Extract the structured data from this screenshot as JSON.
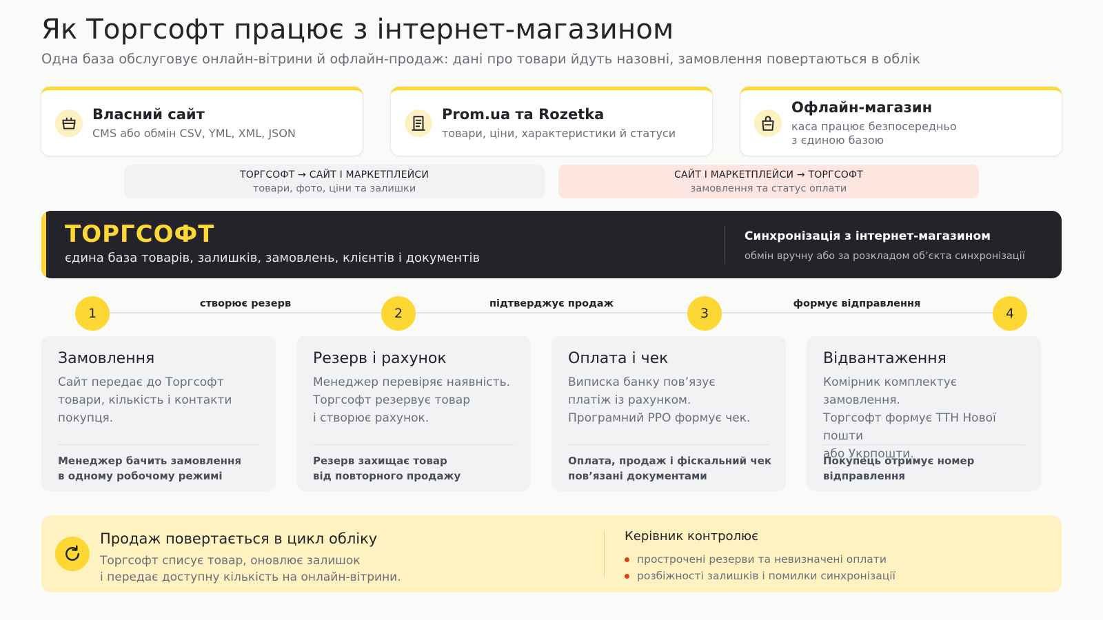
{
  "header": {
    "title": "Як Торгсофт працює з інтернет-магазином",
    "subtitle": "Одна база обслуговує онлайн-вітрини й офлайн-продаж: дані про товари йдуть назовні, замовлення повертаються в облік"
  },
  "sources": [
    {
      "name": "Власний сайт",
      "desc": "CMS або обмін CSV, YML, XML, JSON",
      "icon": "shopping-basket-icon"
    },
    {
      "name": "Prom.ua та Rozetka",
      "desc": "товари, ціни, характеристики й статуси",
      "icon": "receipt-icon"
    },
    {
      "name": "Офлайн-магазин",
      "desc_line1": "каса працює безпосередньо",
      "desc_line2": "з єдиною базою",
      "icon": "shopping-bag-icon"
    }
  ],
  "flows": {
    "outbound": {
      "heading": "ТОРГСОФТ → САЙТ І МАРКЕТПЛЕЙСИ",
      "detail": "товари, фото, ціни та залишки"
    },
    "inbound": {
      "heading": "САЙТ І МАРКЕТПЛЕЙСИ → ТОРГСОФТ",
      "detail": "замовлення та статус оплати"
    }
  },
  "core": {
    "name": "ТОРГСОФТ",
    "desc": "єдина база товарів, залишків, замовлень, клієнтів і документів",
    "sync_title": "Синхронізація з інтернет-магазином",
    "sync_desc": "обмін вручну або за розкладом об’єкта синхронізації"
  },
  "timeline": {
    "nodes": [
      "1",
      "2",
      "3",
      "4"
    ],
    "transitions": [
      "створює резерв",
      "підтверджує продаж",
      "формує відправлення"
    ]
  },
  "steps": [
    {
      "title": "Замовлення",
      "desc": [
        "Сайт передає до Торгсофт",
        "товари, кількість і контакти",
        "покупця."
      ],
      "note": [
        "Менеджер бачить замовлення",
        "в одному робочому режимі"
      ]
    },
    {
      "title": "Резерв і рахунок",
      "desc": [
        "Менеджер перевіряє наявність.",
        "Торгсофт резервує товар",
        "і створює рахунок."
      ],
      "note": [
        "Резерв захищає товар",
        "від повторного продажу"
      ]
    },
    {
      "title": "Оплата і чек",
      "desc": [
        "Виписка банку пов’язує",
        "платіж із рахунком.",
        "Програмний РРО формує чек."
      ],
      "note": [
        "Оплата, продаж і фіскальний чек",
        "пов’язані документами"
      ]
    },
    {
      "title": "Відвантаження",
      "desc": [
        "Комірник комплектує замовлення.",
        "Торгсофт формує ТТН Нової пошти",
        "або Укрпошти."
      ],
      "note": [
        "Покупець отримує номер",
        "відправлення"
      ]
    }
  ],
  "summary": {
    "title": "Продаж повертається в цикл обліку",
    "desc_line1": "Торгсофт списує товар, оновлює залишок",
    "desc_line2": "і передає доступну кількість на онлайн-вітрини.",
    "control_title": "Керівник контролює",
    "control_items": [
      "прострочені резерви та невизначені оплати",
      "розбіжності залишків і помилки синхронізації"
    ]
  },
  "colors": {
    "accent": "#fdd835",
    "dark": "#24232a",
    "bullet": "#d84315"
  }
}
